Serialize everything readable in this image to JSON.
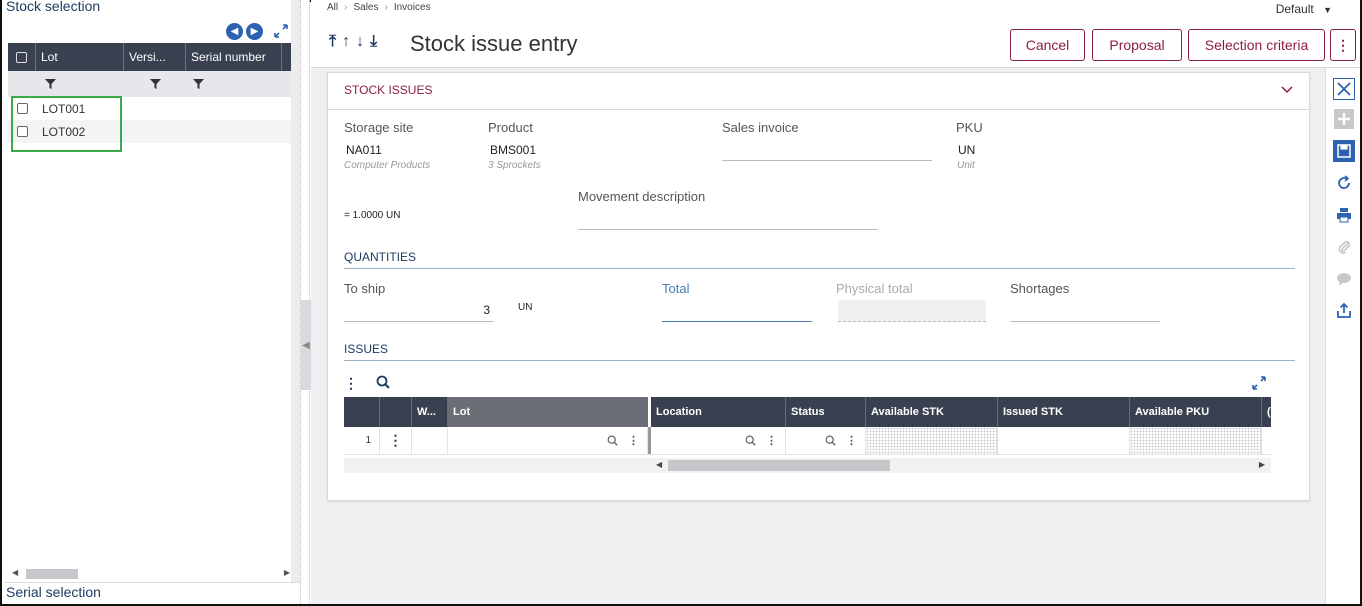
{
  "left_panel": {
    "title": "Stock selection",
    "bottom_title": "Serial selection",
    "columns": [
      "Lot",
      "Versi...",
      "Serial number"
    ],
    "rows": [
      {
        "lot": "LOT001"
      },
      {
        "lot": "LOT002"
      }
    ]
  },
  "breadcrumb": [
    "All",
    "Sales",
    "Invoices"
  ],
  "default_label": "Default",
  "page_title": "Stock issue entry",
  "buttons": {
    "cancel": "Cancel",
    "proposal": "Proposal",
    "selection_criteria": "Selection criteria"
  },
  "stock_issues": {
    "header": "STOCK ISSUES",
    "storage_site_label": "Storage site",
    "storage_site_value": "NA011",
    "storage_site_sub": "Computer Products",
    "product_label": "Product",
    "product_value": "BMS001",
    "product_sub": "3 Sprockets",
    "sales_invoice_label": "Sales invoice",
    "pku_label": "PKU",
    "pku_value": "UN",
    "pku_sub": "Unit",
    "conversion": "= 1.0000 UN",
    "movement_description_label": "Movement description"
  },
  "quantities": {
    "header": "QUANTITIES",
    "to_ship_label": "To ship",
    "to_ship_value": "3",
    "to_ship_unit": "UN",
    "total_label": "Total",
    "physical_total_label": "Physical total",
    "shortages_label": "Shortages"
  },
  "issues": {
    "header": "ISSUES",
    "columns": [
      "W...",
      "Lot",
      "Location",
      "Status",
      "Available STK",
      "Issued STK",
      "Available PKU",
      "("
    ],
    "rows": [
      {
        "line": "1"
      }
    ]
  },
  "colors": {
    "accent": "#8b1e46",
    "header_bg": "#39404f",
    "link_blue": "#2d62b2",
    "highlight_green": "#3bab4a"
  }
}
